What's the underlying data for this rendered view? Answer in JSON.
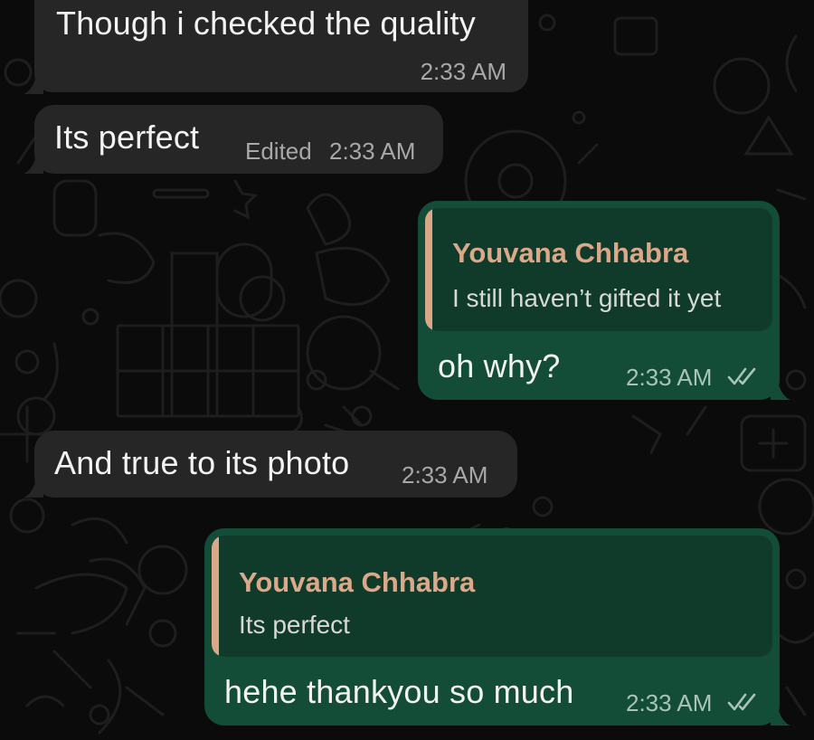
{
  "messages": [
    {
      "direction": "incoming",
      "text": "Though i checked the quality",
      "time": "2:33 AM"
    },
    {
      "direction": "incoming",
      "text": "Its perfect",
      "edited_label": "Edited",
      "time": "2:33 AM"
    },
    {
      "direction": "outgoing",
      "reply_to": {
        "name": "Youvana Chhabra",
        "text": "I still haven’t gifted it yet"
      },
      "text": "oh why?",
      "time": "2:33 AM",
      "status": "read"
    },
    {
      "direction": "incoming",
      "text": "And true to its photo",
      "time": "2:33 AM"
    },
    {
      "direction": "outgoing",
      "reply_to": {
        "name": "Youvana Chhabra",
        "text": "Its perfect"
      },
      "text": "hehe thankyou so much",
      "time": "2:33 AM",
      "status": "read"
    }
  ],
  "colors": {
    "background": "#0b0b0b",
    "incoming_bubble": "#262627",
    "outgoing_bubble": "#144d37",
    "quote_background": "#103b2b",
    "quote_accent": "#d8a888",
    "read_tick": "#a9c4b7"
  },
  "icons": {
    "read_receipt": "double-check-icon",
    "wallpaper": "doodle-pattern"
  }
}
